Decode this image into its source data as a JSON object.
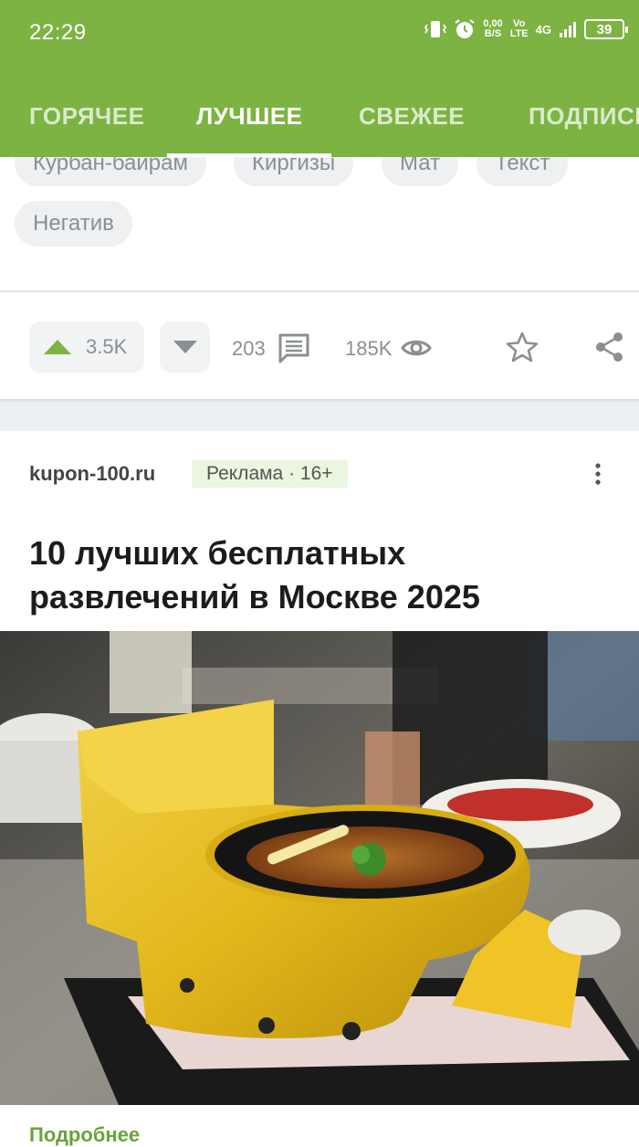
{
  "status_bar": {
    "time": "22:29",
    "net_speed_top": "0,00",
    "net_speed_bottom": "B/S",
    "volte_top": "Vo",
    "volte_bottom": "LTE",
    "network_type": "4G",
    "battery": "39"
  },
  "tabs": [
    {
      "label": "ГОРЯЧЕЕ",
      "active": false
    },
    {
      "label": "ЛУЧШЕЕ",
      "active": true
    },
    {
      "label": "СВЕЖЕЕ",
      "active": false
    },
    {
      "label": "ПОДПИСКИ",
      "active": false
    }
  ],
  "tags": [
    "Курбан-байрам",
    "Киргизы",
    "Мат",
    "Текст",
    "Негатив"
  ],
  "post_actions": {
    "rating": "3.5K",
    "comments": "203",
    "views": "185K"
  },
  "ad": {
    "domain": "kupon-100.ru",
    "label": "Реклама · 16+",
    "title": "10 лучших бесплатных развлечений в Москве 2025",
    "more": "Подробнее"
  },
  "colors": {
    "brand_green": "#7cb342",
    "ad_label_bg": "#eaf6df",
    "link_green": "#6aa33a"
  }
}
